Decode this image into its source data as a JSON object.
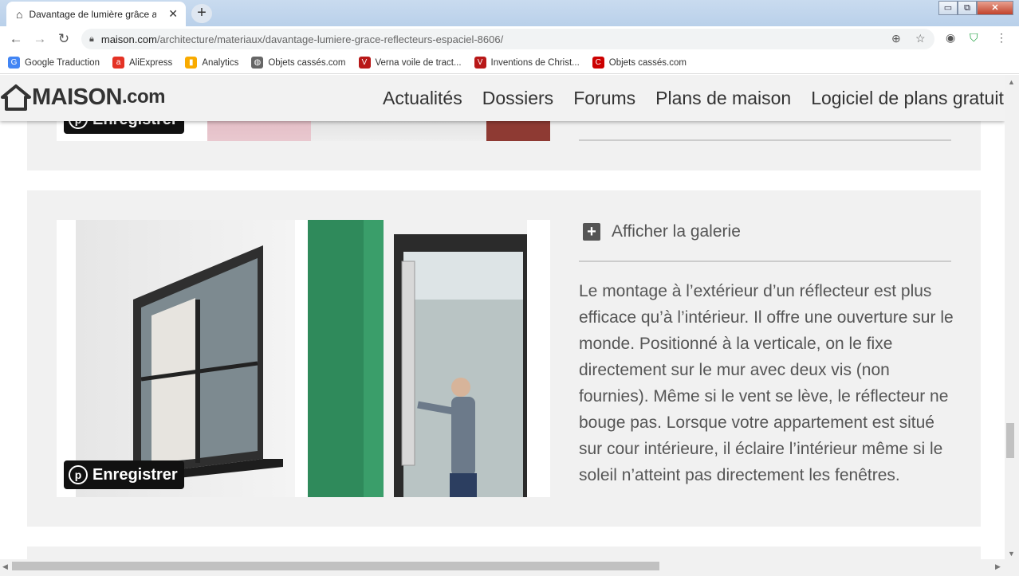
{
  "browser": {
    "tab_title": "Davantage de lumière grâce aux",
    "tab_close": "✕",
    "new_tab": "+",
    "url_domain": "maison.com",
    "url_path": "/architecture/materiaux/davantage-lumiere-grace-reflecteurs-espaciel-8606/",
    "window_controls": [
      "▭",
      "⧉",
      "✕"
    ],
    "nav": {
      "back": "←",
      "forward": "→",
      "reload": "↻"
    },
    "toolbar_icons": {
      "zoom": "⊕",
      "star": "☆",
      "profile": "◉",
      "shield": "⛉",
      "menu": "⋮"
    }
  },
  "bookmarks": [
    {
      "label": "Google Traduction",
      "icon": "google-translate-icon",
      "glyph": "G",
      "color": "#4285f4"
    },
    {
      "label": "AliExpress",
      "icon": "aliexpress-icon",
      "glyph": "a",
      "color": "#e43225"
    },
    {
      "label": "Analytics",
      "icon": "analytics-icon",
      "glyph": "▮",
      "color": "#f9ab00"
    },
    {
      "label": "Objets cassés.com",
      "icon": "globe-icon",
      "glyph": "◍",
      "color": "#666666"
    },
    {
      "label": "Verna voile de tract...",
      "icon": "verna-icon",
      "glyph": "V",
      "color": "#b81818"
    },
    {
      "label": "Inventions de Christ...",
      "icon": "inventions-icon",
      "glyph": "V",
      "color": "#b81818"
    },
    {
      "label": "Objets cassés.com",
      "icon": "objets-casses-icon",
      "glyph": "C",
      "color": "#cc0000"
    }
  ],
  "site": {
    "logo_text": "MAISON",
    "logo_suffix": ".com",
    "nav": [
      "Actualités",
      "Dossiers",
      "Forums",
      "Plans de maison",
      "Logiciel de plans gratuit"
    ]
  },
  "cards": {
    "pin_label": "Enregistrer",
    "pin_glyph": "p",
    "gallery_label": "Afficher la galerie",
    "gallery_plus": "+",
    "description": "Le montage à l’extérieur d’un réflecteur est plus efficace qu’à l’intérieur. Il offre une ouverture sur le monde. Positionné à la verticale, on le fixe directement sur le mur avec deux vis (non fournies). Même si le vent se lève, le réflecteur ne bouge pas. Lorsque votre appartement est situé sur cour intérieure, il éclaire l’intérieur même si le soleil n’atteint pas directement les fenêtres."
  },
  "colors": {
    "accent_green": "#3a9e6a",
    "text_gray": "#555555",
    "card_bg": "#f1f1f1"
  }
}
